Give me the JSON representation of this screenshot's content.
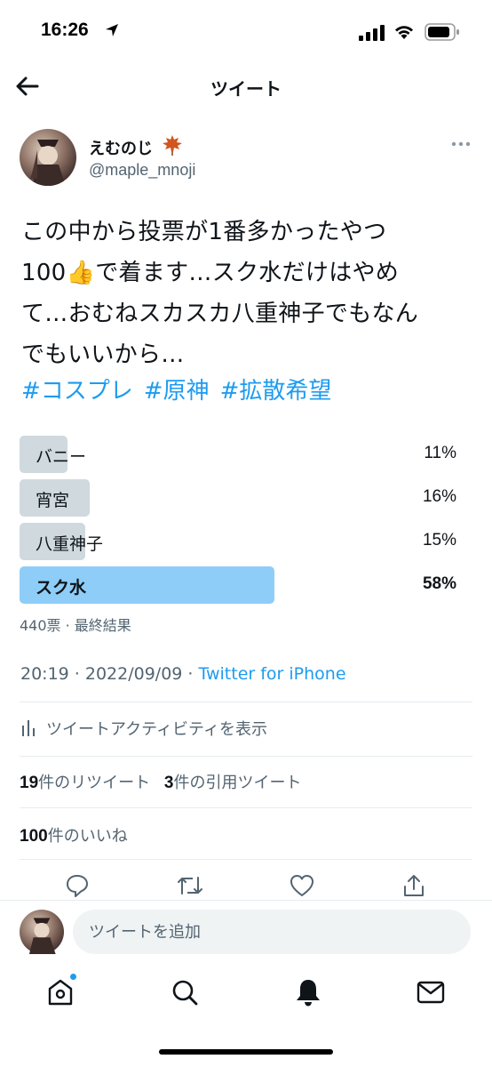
{
  "status_bar": {
    "time": "16:26"
  },
  "nav": {
    "title": "ツイート"
  },
  "author": {
    "name": "えむのじ",
    "handle": "@maple_mnoji"
  },
  "tweet": {
    "text": "この中から投票が1番多かったやつ\n100👍で着ます…スク水だけはやめ\nて…おむねスカスカ八重神子でもなん\nでもいいから…",
    "hashtags": [
      "#コスプレ",
      "#原神",
      "#拡散希望"
    ]
  },
  "poll": {
    "options": [
      {
        "label": "バニー",
        "percent_text": "11%",
        "percent": 11,
        "winner": false
      },
      {
        "label": "宵宮",
        "percent_text": "16%",
        "percent": 16,
        "winner": false
      },
      {
        "label": "八重神子",
        "percent_text": "15%",
        "percent": 15,
        "winner": false
      },
      {
        "label": "スク水",
        "percent_text": "58%",
        "percent": 58,
        "winner": true
      }
    ],
    "meta": "440票 · 最終結果"
  },
  "timestamp": {
    "datetime": "20:19 · 2022/09/09 · ",
    "source": "Twitter for iPhone"
  },
  "activity": {
    "label": "ツイートアクティビティを表示"
  },
  "stats": {
    "retweets_count": "19",
    "retweets_label": "件のリツイート",
    "quotes_count": "3",
    "quotes_label": "件の引用ツイート",
    "likes_count": "100",
    "likes_label": "件のいいね"
  },
  "reply": {
    "placeholder": "ツイートを追加"
  },
  "colors": {
    "accent": "#1d9bf0",
    "poll_winner": "#8ecdf8",
    "poll_other": "#cfd9de",
    "secondary_text": "#536471"
  },
  "icons": [
    "back-arrow-icon",
    "location-arrow-icon",
    "signal-icon",
    "wifi-icon",
    "battery-icon",
    "maple-leaf-icon",
    "more-icon",
    "activity-icon",
    "reply-icon",
    "retweet-icon",
    "like-icon",
    "share-icon",
    "home-icon",
    "search-icon",
    "bell-icon",
    "mail-icon"
  ]
}
